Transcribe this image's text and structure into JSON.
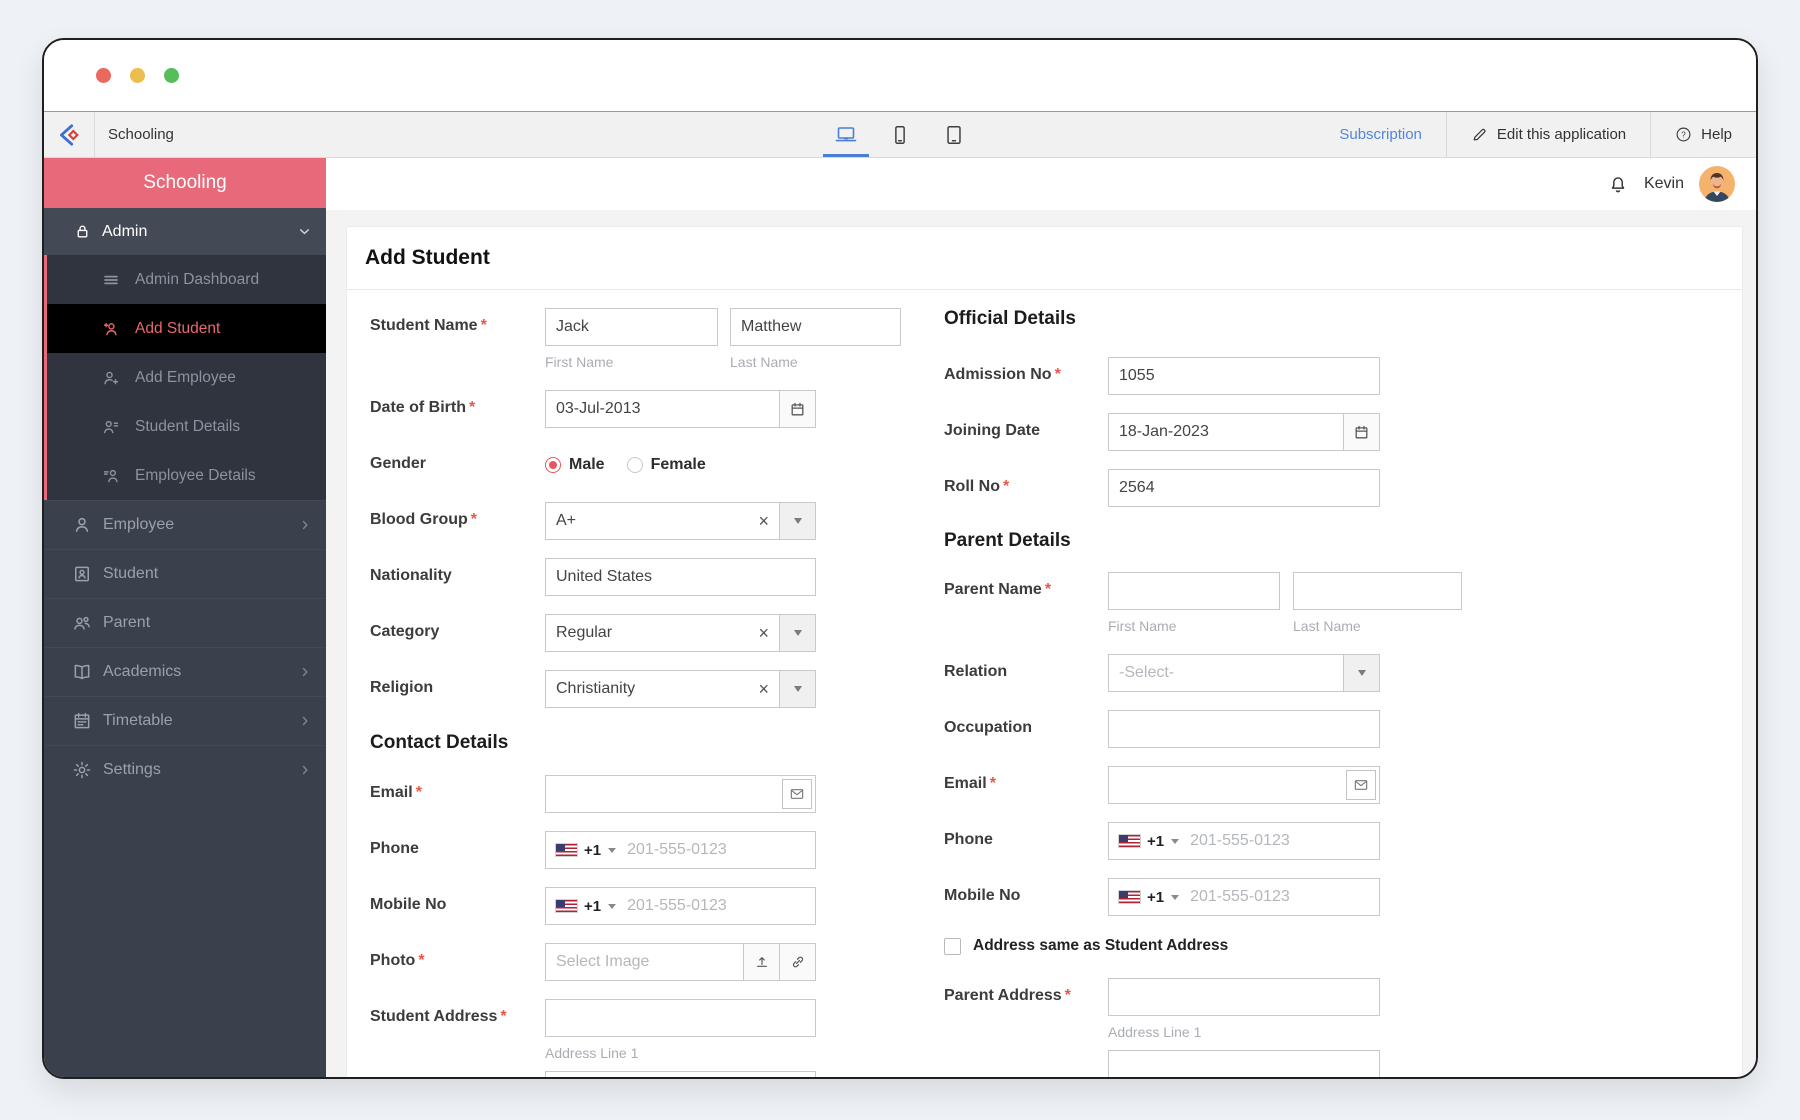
{
  "toolbar": {
    "app_name": "Schooling",
    "subscription": "Subscription",
    "edit_application": "Edit this application",
    "help": "Help"
  },
  "header": {
    "user_name": "Kevin"
  },
  "sidebar": {
    "title": "Schooling",
    "admin_label": "Admin",
    "admin_items": [
      {
        "label": "Admin Dashboard",
        "icon": "dashboard-icon"
      },
      {
        "label": "Add Student",
        "icon": "add-student-icon"
      },
      {
        "label": "Add Employee",
        "icon": "add-employee-icon"
      },
      {
        "label": "Student Details",
        "icon": "student-details-icon"
      },
      {
        "label": "Employee Details",
        "icon": "employee-details-icon"
      }
    ],
    "items": [
      {
        "label": "Employee",
        "icon": "employee-icon"
      },
      {
        "label": "Student",
        "icon": "student-icon"
      },
      {
        "label": "Parent",
        "icon": "parent-icon"
      },
      {
        "label": "Academics",
        "icon": "academics-icon"
      },
      {
        "label": "Timetable",
        "icon": "timetable-icon"
      },
      {
        "label": "Settings",
        "icon": "settings-icon"
      }
    ]
  },
  "form": {
    "title": "Add Student",
    "required_mark": "*",
    "sections": {
      "contact": "Contact Details",
      "official": "Official Details",
      "parent": "Parent Details"
    },
    "student_name": {
      "label": "Student Name",
      "first_name": "Jack",
      "last_name": "Matthew",
      "first_hint": "First Name",
      "last_hint": "Last Name"
    },
    "dob": {
      "label": "Date of Birth",
      "value": "03-Jul-2013"
    },
    "gender": {
      "label": "Gender",
      "male": "Male",
      "female": "Female",
      "selected": "Male"
    },
    "blood_group": {
      "label": "Blood Group",
      "value": "A+"
    },
    "nationality": {
      "label": "Nationality",
      "value": "United States"
    },
    "category": {
      "label": "Category",
      "value": "Regular"
    },
    "religion": {
      "label": "Religion",
      "value": "Christianity"
    },
    "email": {
      "label": "Email",
      "value": ""
    },
    "phone": {
      "label": "Phone",
      "code": "+1",
      "placeholder": "201-555-0123"
    },
    "mobile": {
      "label": "Mobile No",
      "code": "+1",
      "placeholder": "201-555-0123"
    },
    "photo": {
      "label": "Photo",
      "placeholder": "Select Image"
    },
    "student_address": {
      "label": "Student Address",
      "hint": "Address Line 1"
    },
    "admission_no": {
      "label": "Admission No",
      "value": "1055"
    },
    "joining_date": {
      "label": "Joining Date",
      "value": "18-Jan-2023"
    },
    "roll_no": {
      "label": "Roll No",
      "value": "2564"
    },
    "parent_name": {
      "label": "Parent Name",
      "first_hint": "First Name",
      "last_hint": "Last Name"
    },
    "relation": {
      "label": "Relation",
      "placeholder": "-Select-"
    },
    "occupation": {
      "label": "Occupation"
    },
    "parent_email": {
      "label": "Email"
    },
    "parent_phone": {
      "label": "Phone",
      "code": "+1",
      "placeholder": "201-555-0123"
    },
    "parent_mobile": {
      "label": "Mobile No",
      "code": "+1",
      "placeholder": "201-555-0123"
    },
    "address_same": {
      "label": "Address same as Student Address",
      "checked": false
    },
    "parent_address": {
      "label": "Parent Address",
      "hint": "Address Line 1"
    }
  },
  "colors": {
    "accent_blue": "#4b7fd6",
    "salmon": "#e8697a",
    "sidebar_dark": "#3a404c",
    "required_red": "#e85648"
  }
}
